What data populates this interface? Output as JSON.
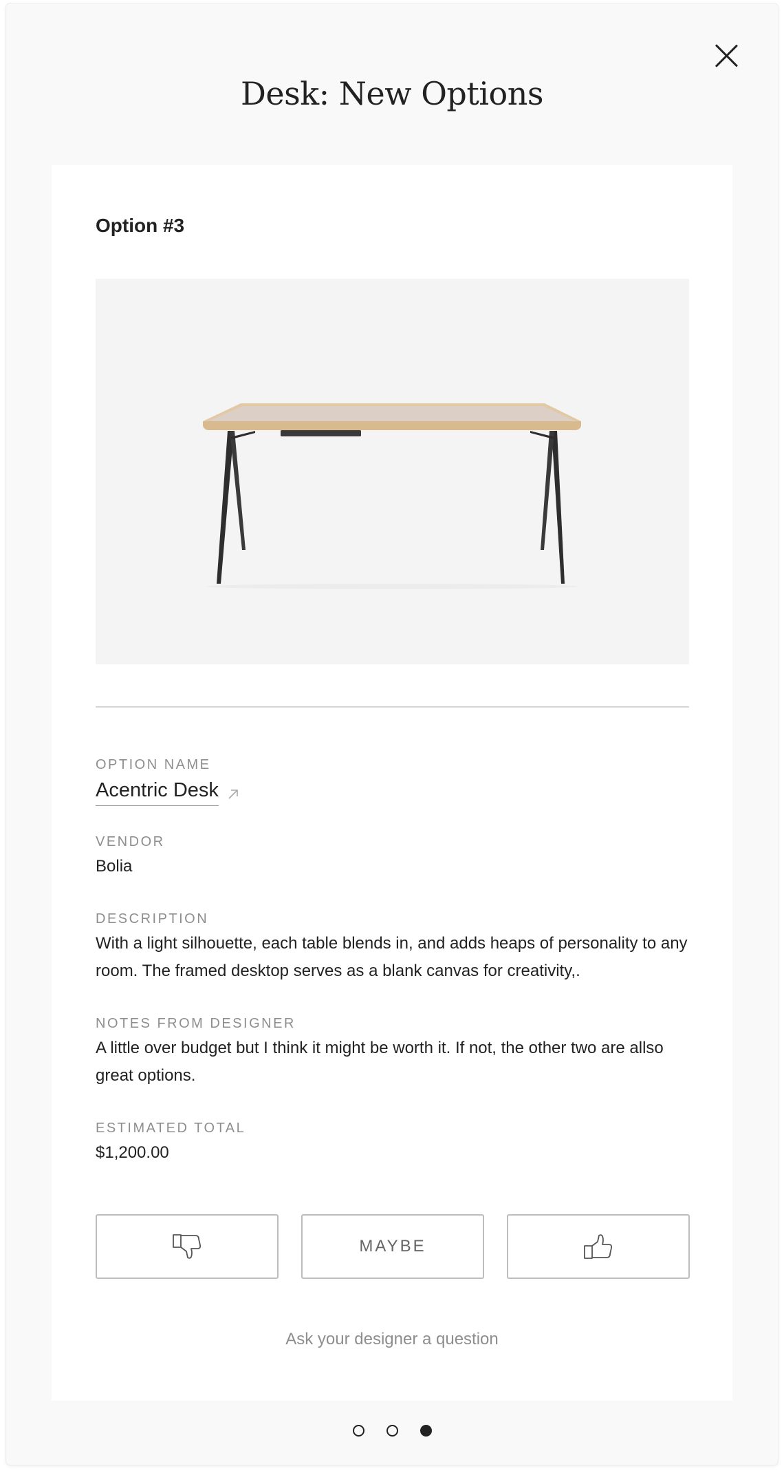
{
  "modal": {
    "title": "Desk: New Options",
    "close_icon": "close-icon"
  },
  "option": {
    "heading": "Option #3",
    "image_alt_icon": "desk-image",
    "fields": {
      "name_label": "OPTION NAME",
      "name_value": "Acentric Desk",
      "vendor_label": "VENDOR",
      "vendor_value": "Bolia",
      "description_label": "DESCRIPTION",
      "description_value": "With a light silhouette, each table blends in, and adds heaps of personality to any room. The framed desktop serves as a blank canvas for creativity,.",
      "notes_label": "NOTES FROM DESIGNER",
      "notes_value": "A little over budget but I think it might be worth it.  If not, the other two are allso great options.",
      "total_label": "ESTIMATED TOTAL",
      "total_value": "$1,200.00"
    }
  },
  "actions": {
    "dislike_icon": "thumbs-down-icon",
    "maybe_label": "MAYBE",
    "like_icon": "thumbs-up-icon",
    "ask_label": "Ask your designer a question"
  },
  "pagination": {
    "total": 3,
    "current": 3
  }
}
